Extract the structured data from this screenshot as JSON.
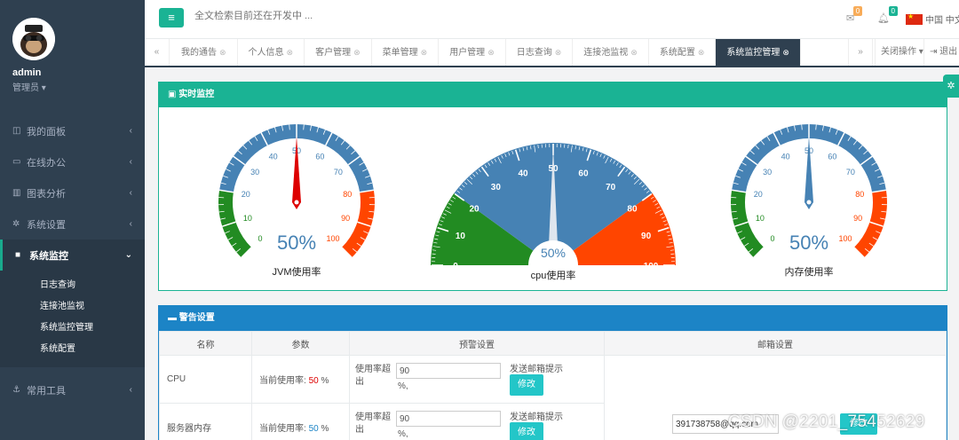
{
  "sidebar": {
    "user_name": "admin",
    "user_role": "管理员",
    "items": [
      {
        "label": "我的面板",
        "icon": "columns-icon"
      },
      {
        "label": "在线办公",
        "icon": "desktop-icon"
      },
      {
        "label": "图表分析",
        "icon": "bar-chart-icon"
      },
      {
        "label": "系统设置",
        "icon": "gear-icon"
      },
      {
        "label": "系统监控",
        "icon": "video-icon"
      }
    ],
    "subitems": [
      "日志查询",
      "连接池监视",
      "系统监控管理",
      "系统配置"
    ],
    "tools_label": "常用工具"
  },
  "header": {
    "search_placeholder": "全文检索目前还在开发中 ...",
    "msg_count": "0",
    "bell_count": "0",
    "lang_label": "中国 中文"
  },
  "tabs": [
    "我的通告",
    "个人信息",
    "客户管理",
    "菜单管理",
    "用户管理",
    "日志查询",
    "连接池监视",
    "系统配置",
    "系统监控管理"
  ],
  "tab_actions": {
    "close_ops": "关闭操作",
    "logout": "退出"
  },
  "monitor": {
    "title": "实时监控",
    "gauges": [
      {
        "label": "JVM使用率",
        "value": 50,
        "value_text": "50%"
      },
      {
        "label": "cpu使用率",
        "value": 50,
        "value_text": "50%"
      },
      {
        "label": "内存使用率",
        "value": 50,
        "value_text": "50%"
      }
    ],
    "scale": [
      "0",
      "10",
      "20",
      "30",
      "40",
      "50",
      "60",
      "70",
      "80",
      "90",
      "100"
    ],
    "colors": {
      "green": "#228b22",
      "blue": "#4682b4",
      "orange": "#ff4500"
    }
  },
  "alert": {
    "title": "警告设置",
    "headers": [
      "名称",
      "参数",
      "预警设置",
      "邮箱设置"
    ],
    "rows": [
      {
        "name": "CPU",
        "param_prefix": "当前使用率:",
        "usage": "50",
        "unit": "%",
        "warn_label": "使用率超出",
        "warn_value": "90",
        "warn_pct": "%,",
        "send_label": "发送邮箱提示",
        "edit": "修改"
      },
      {
        "name": "服务器内存",
        "param_prefix": "当前使用率:",
        "usage": "50",
        "unit": "%",
        "warn_label": "使用率超出",
        "warn_value": "90",
        "warn_pct": "%,",
        "send_label": "发送邮箱提示",
        "edit": "修改"
      }
    ],
    "email_value": "391738758@qq.com",
    "email_btn": "修改"
  },
  "watermark": "CSDN @2201_75452629"
}
